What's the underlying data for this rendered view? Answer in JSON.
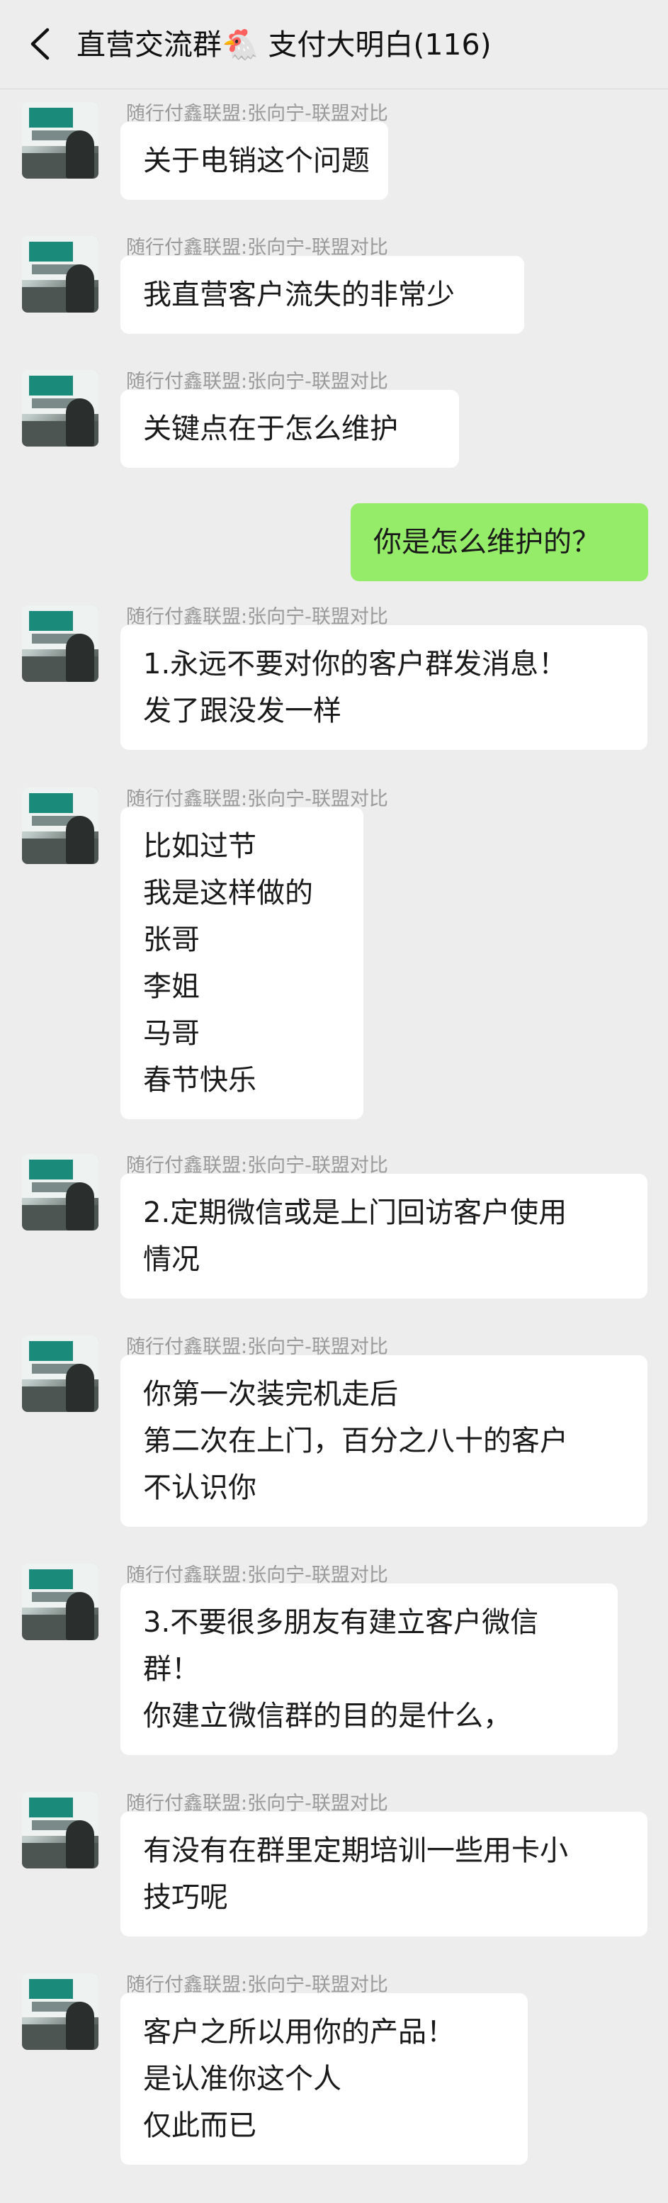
{
  "header": {
    "title": "直营交流群",
    "emoji": "🐔",
    "subtitle": "支付大明白(116)"
  },
  "messages": [
    {
      "sender": "随行付鑫联盟:张向宁-联盟对比",
      "lines": [
        "关于电销这个问题"
      ]
    },
    {
      "sender": "随行付鑫联盟:张向宁-联盟对比",
      "lines": [
        "我直营客户流失的非常少"
      ]
    },
    {
      "sender": "随行付鑫联盟:张向宁-联盟对比",
      "lines": [
        "关键点在于怎么维护"
      ]
    },
    {
      "sender": "",
      "self": true,
      "lines": [
        "你是怎么维护的？"
      ]
    },
    {
      "sender": "随行付鑫联盟:张向宁-联盟对比",
      "lines": [
        "1.永远不要对你的客户群发消息！",
        "发了跟没发一样"
      ]
    },
    {
      "sender": "随行付鑫联盟:张向宁-联盟对比",
      "lines": [
        "比如过节",
        "我是这样做的",
        "张哥",
        "李姐",
        "马哥",
        "春节快乐"
      ]
    },
    {
      "sender": "随行付鑫联盟:张向宁-联盟对比",
      "lines": [
        "2.定期微信或是上门回访客户使用",
        "情况"
      ]
    },
    {
      "sender": "随行付鑫联盟:张向宁-联盟对比",
      "lines": [
        "你第一次装完机走后",
        "第二次在上门，百分之八十的客户",
        "不认识你"
      ]
    },
    {
      "sender": "随行付鑫联盟:张向宁-联盟对比",
      "lines": [
        "3.不要很多朋友有建立客户微信",
        "群！",
        "你建立微信群的目的是什么，"
      ]
    },
    {
      "sender": "随行付鑫联盟:张向宁-联盟对比",
      "lines": [
        "有没有在群里定期培训一些用卡小",
        "技巧呢"
      ]
    },
    {
      "sender": "随行付鑫联盟:张向宁-联盟对比",
      "lines": [
        "客户之所以用你的产品！",
        "是认准你这个人",
        "仅此而已"
      ]
    }
  ]
}
